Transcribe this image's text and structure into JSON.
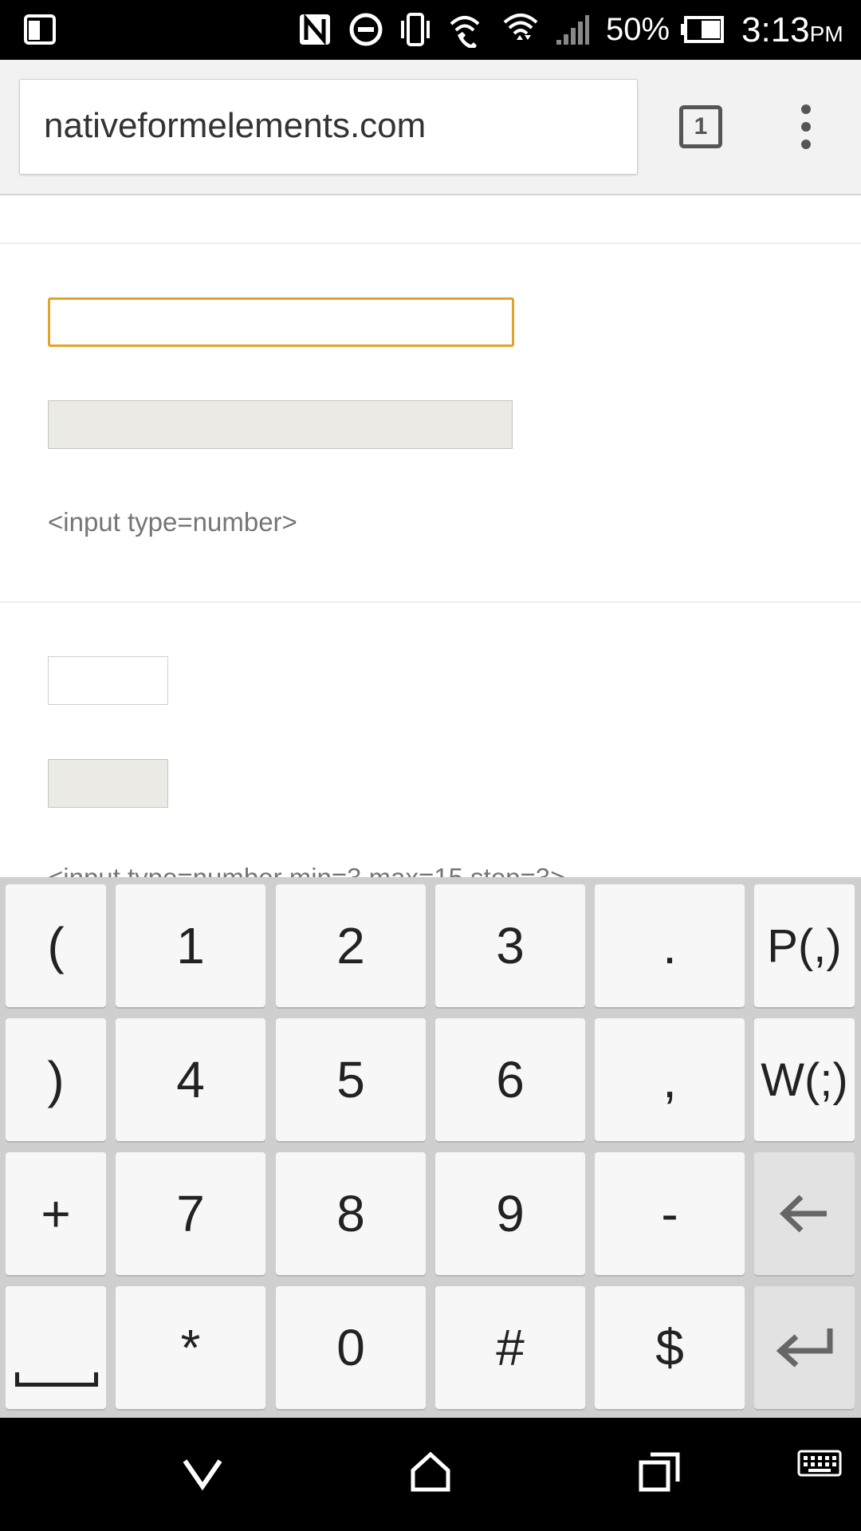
{
  "status_bar": {
    "battery_percent": "50%",
    "time": "3:13",
    "time_suffix": "PM",
    "icons": [
      "screen-mirror-icon",
      "nfc-icon",
      "do-not-disturb-icon",
      "vibrate-icon",
      "wifi-calling-icon",
      "wifi-icon",
      "cell-signal-icon",
      "battery-icon"
    ]
  },
  "browser": {
    "url": "nativeformelements.com",
    "tab_count": "1"
  },
  "page": {
    "caption_number": "<input type=number>",
    "caption_partial": "<input type=number min=3 max=15 step=3>"
  },
  "keyboard": {
    "rows": [
      [
        "(",
        "1",
        "2",
        "3",
        ".",
        "P(,)"
      ],
      [
        ")",
        "4",
        "5",
        "6",
        ",",
        "W(;)"
      ],
      [
        "+",
        "7",
        "8",
        "9",
        "-",
        "←"
      ],
      [
        "␣",
        "*",
        "0",
        "#",
        "$",
        "↵"
      ]
    ]
  },
  "nav_bar": {
    "icons": [
      "back-chevron-icon",
      "home-icon",
      "recents-icon",
      "keyboard-icon"
    ]
  },
  "colors": {
    "focus_border": "#e2a32a",
    "disabled_bg": "#ebeae4"
  }
}
